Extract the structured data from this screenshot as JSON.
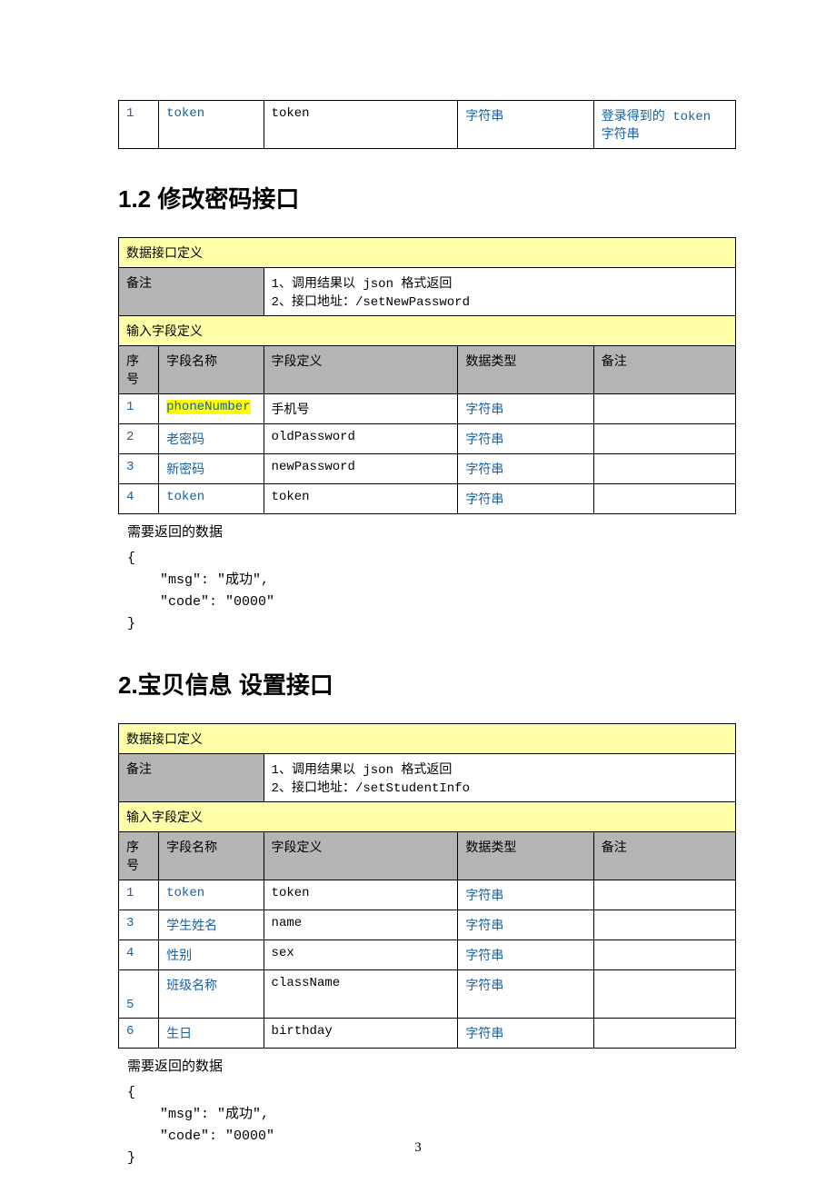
{
  "topTable": {
    "row": {
      "seq": "1",
      "name": "token",
      "def": "token",
      "type": "字符串",
      "note_prefix": "登录得到的 ",
      "note_mono": "token ",
      "note_suffix": "字符串"
    }
  },
  "section12": {
    "title": "1.2 修改密码接口",
    "def_label": "数据接口定义",
    "remark_label": "备注",
    "remark_line1_prefix": "1、调用结果以 ",
    "remark_line1_mono": "json ",
    "remark_line1_suffix": "格式返回",
    "remark_line2_prefix": "2、接口地址：",
    "remark_line2_mono": "/setNewPassword",
    "input_label": "输入字段定义",
    "headers": {
      "seq": "序号",
      "name": "字段名称",
      "def": "字段定义",
      "type": "数据类型",
      "note": "备注"
    },
    "rows": [
      {
        "seq": "1",
        "name": "phoneNumber",
        "name_highlight": true,
        "name_mono": true,
        "def": "手机号",
        "def_mono": false,
        "type": "字符串",
        "note": ""
      },
      {
        "seq": "2",
        "name": "老密码",
        "name_highlight": false,
        "name_mono": false,
        "def": "oldPassword",
        "def_mono": true,
        "type": "字符串",
        "note": ""
      },
      {
        "seq": "3",
        "name": "新密码",
        "name_highlight": false,
        "name_mono": false,
        "def": "newPassword",
        "def_mono": true,
        "type": "字符串",
        "note": ""
      },
      {
        "seq": "4",
        "name": "token",
        "name_highlight": false,
        "name_mono": true,
        "def": "token",
        "def_mono": true,
        "type": "字符串",
        "note": ""
      }
    ],
    "return_label": "需要返回的数据",
    "return_brace_open": "{",
    "return_line1": "    \"msg\": \"成功\",",
    "return_line2": "    \"code\": \"0000\"",
    "return_brace_close": "}"
  },
  "section2": {
    "title": "2.宝贝信息 设置接口",
    "def_label": "数据接口定义",
    "remark_label": "备注",
    "remark_line1_prefix": "1、调用结果以 ",
    "remark_line1_mono": "json ",
    "remark_line1_suffix": "格式返回",
    "remark_line2_prefix": "2、接口地址：",
    "remark_line2_mono": "/setStudentInfo",
    "input_label": "输入字段定义",
    "headers": {
      "seq": "序号",
      "name": "字段名称",
      "def": "字段定义",
      "type": "数据类型",
      "note": "备注"
    },
    "rows": [
      {
        "seq": "1",
        "name": "token",
        "name_mono": true,
        "def": "token",
        "def_mono": true,
        "type": "字符串",
        "note": ""
      },
      {
        "seq": "3",
        "name": "学生姓名",
        "name_mono": false,
        "def": "name",
        "def_mono": true,
        "type": "字符串",
        "note": ""
      },
      {
        "seq": "4",
        "name": "性别",
        "name_mono": false,
        "def": "sex",
        "def_mono": true,
        "type": "字符串",
        "note": ""
      },
      {
        "seq": "5",
        "name": "班级名称",
        "name_mono": false,
        "def": "className",
        "def_mono": true,
        "type": "字符串",
        "note": "",
        "tall": true
      },
      {
        "seq": "6",
        "name": "生日",
        "name_mono": false,
        "def": "birthday",
        "def_mono": true,
        "type": "字符串",
        "note": ""
      }
    ],
    "return_label": "需要返回的数据",
    "return_brace_open": "{",
    "return_line1": "    \"msg\": \"成功\",",
    "return_line2": "    \"code\": \"0000\"",
    "return_brace_close": "}"
  },
  "page_number": "3"
}
